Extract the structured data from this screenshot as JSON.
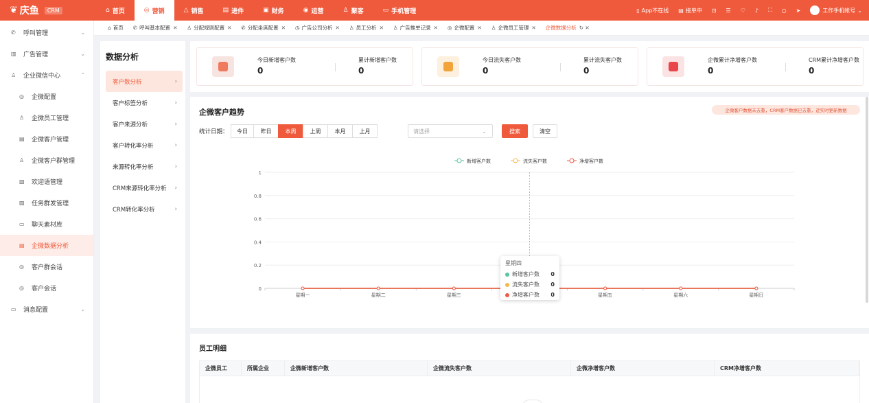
{
  "app": {
    "logo_text": "庆鱼",
    "logo_badge": "CRM"
  },
  "nav": [
    {
      "label": "首页",
      "icon": "⌂"
    },
    {
      "label": "营销",
      "icon": "◎",
      "active": true
    },
    {
      "label": "销售",
      "icon": "△"
    },
    {
      "label": "进件",
      "icon": "▤"
    },
    {
      "label": "财务",
      "icon": "▣"
    },
    {
      "label": "运营",
      "icon": "◉"
    },
    {
      "label": "聚客",
      "icon": "♙"
    },
    {
      "label": "手机管理",
      "icon": "▭"
    }
  ],
  "topright": {
    "app_status": "App不在线",
    "dial": "接单中",
    "account": "工作手机帐号"
  },
  "sidebar": [
    {
      "label": "呼叫管理",
      "icon": "✆",
      "chev": "⌄"
    },
    {
      "label": "广告管理",
      "icon": "▥",
      "chev": "⌄"
    },
    {
      "label": "企业微信中心",
      "icon": "♙",
      "chev": "⌃"
    },
    {
      "label": "企微配置",
      "icon": "◎",
      "sub": true
    },
    {
      "label": "企微员工管理",
      "icon": "♙",
      "sub": true
    },
    {
      "label": "企微客户管理",
      "icon": "▤",
      "sub": true
    },
    {
      "label": "企微客户群管理",
      "icon": "♙",
      "sub": true
    },
    {
      "label": "欢迎语管理",
      "icon": "▧",
      "sub": true
    },
    {
      "label": "任务群发管理",
      "icon": "▨",
      "sub": true
    },
    {
      "label": "聊天素材库",
      "icon": "▭",
      "sub": true
    },
    {
      "label": "企微数据分析",
      "icon": "▤",
      "sub": true,
      "active": true
    },
    {
      "label": "客户群会话",
      "icon": "◎",
      "sub": true
    },
    {
      "label": "客户会话",
      "icon": "◎",
      "sub": true
    },
    {
      "label": "消息配置",
      "icon": "▭",
      "chev": "⌄"
    }
  ],
  "tabs": [
    {
      "label": "首页",
      "icon": "⌂",
      "close": ""
    },
    {
      "label": "呼叫基本配置",
      "icon": "✆",
      "close": "✕"
    },
    {
      "label": "分配规则配置",
      "icon": "♙",
      "close": "✕"
    },
    {
      "label": "分配坐席配置",
      "icon": "✆",
      "close": "✕"
    },
    {
      "label": "广告公司分析",
      "icon": "◷",
      "close": "✕"
    },
    {
      "label": "员工分析",
      "icon": "♙",
      "close": "✕"
    },
    {
      "label": "广告推单记录",
      "icon": "♙",
      "close": "✕"
    },
    {
      "label": "企微配置",
      "icon": "◎",
      "close": "✕"
    },
    {
      "label": "企微员工管理",
      "icon": "♙",
      "close": "✕"
    },
    {
      "label": "企微数据分析",
      "icon": "",
      "close": "↻ ✕",
      "active": true
    }
  ],
  "left_panel": {
    "title": "数据分析",
    "items": [
      "客户数分析",
      "客户标签分析",
      "客户来源分析",
      "客户转化率分析",
      "来源转化率分析",
      "CRM来源转化率分析",
      "CRM转化率分析"
    ],
    "chev": "›"
  },
  "stats": [
    {
      "label1": "今日新增客户数",
      "value1": "0",
      "label2": "累计新增客户数",
      "value2": "0",
      "color": "#f7e3e0",
      "mark": "#f07a5e"
    },
    {
      "label1": "今日流失客户数",
      "value1": "0",
      "label2": "累计流失客户数",
      "value2": "0",
      "color": "#fdf0de",
      "mark": "#f2a33a"
    },
    {
      "label1": "企微累计净增客户数",
      "value1": "0",
      "label2": "CRM累计净增客户数",
      "value2": "0",
      "color": "#fbe3e3",
      "mark": "#e8464a"
    }
  ],
  "chart_panel": {
    "title": "企微客户趋势",
    "notice": "企微客户数据未去重，CRM客户数据已去重，近实时更新数据",
    "filter_label": "统计日期：",
    "date_buttons": [
      "今日",
      "昨日",
      "本周",
      "上周",
      "本月",
      "上月"
    ],
    "active_button": 2,
    "select_placeholder": "请选择",
    "search_label": "搜索",
    "clear_label": "清空"
  },
  "chart_data": {
    "type": "line",
    "categories": [
      "星期一",
      "星期二",
      "星期三",
      "星期四",
      "星期五",
      "星期六",
      "星期日"
    ],
    "ylim": [
      0,
      1
    ],
    "yticks": [
      "0",
      "0.2",
      "0.4",
      "0.6",
      "0.8",
      "1"
    ],
    "series": [
      {
        "name": "新增客户数",
        "values": [
          0,
          0,
          0,
          0,
          0,
          0,
          0
        ],
        "color": "#5cc5a0"
      },
      {
        "name": "流失客户数",
        "values": [
          0,
          0,
          0,
          0,
          0,
          0,
          0
        ],
        "color": "#f5b84a"
      },
      {
        "name": "净增客户数",
        "values": [
          0,
          0,
          0,
          0,
          0,
          0,
          0
        ],
        "color": "#f05a4a"
      }
    ],
    "grid": true,
    "legend": "top-center",
    "hover_index": 3
  },
  "tooltip": {
    "title": "星期四"
  },
  "detail": {
    "title": "员工明细",
    "columns": [
      "企微员工",
      "所属企业",
      "企微新增客户数",
      "企微流失客户数",
      "企微净增客户数",
      "CRM净增客户数"
    ]
  }
}
